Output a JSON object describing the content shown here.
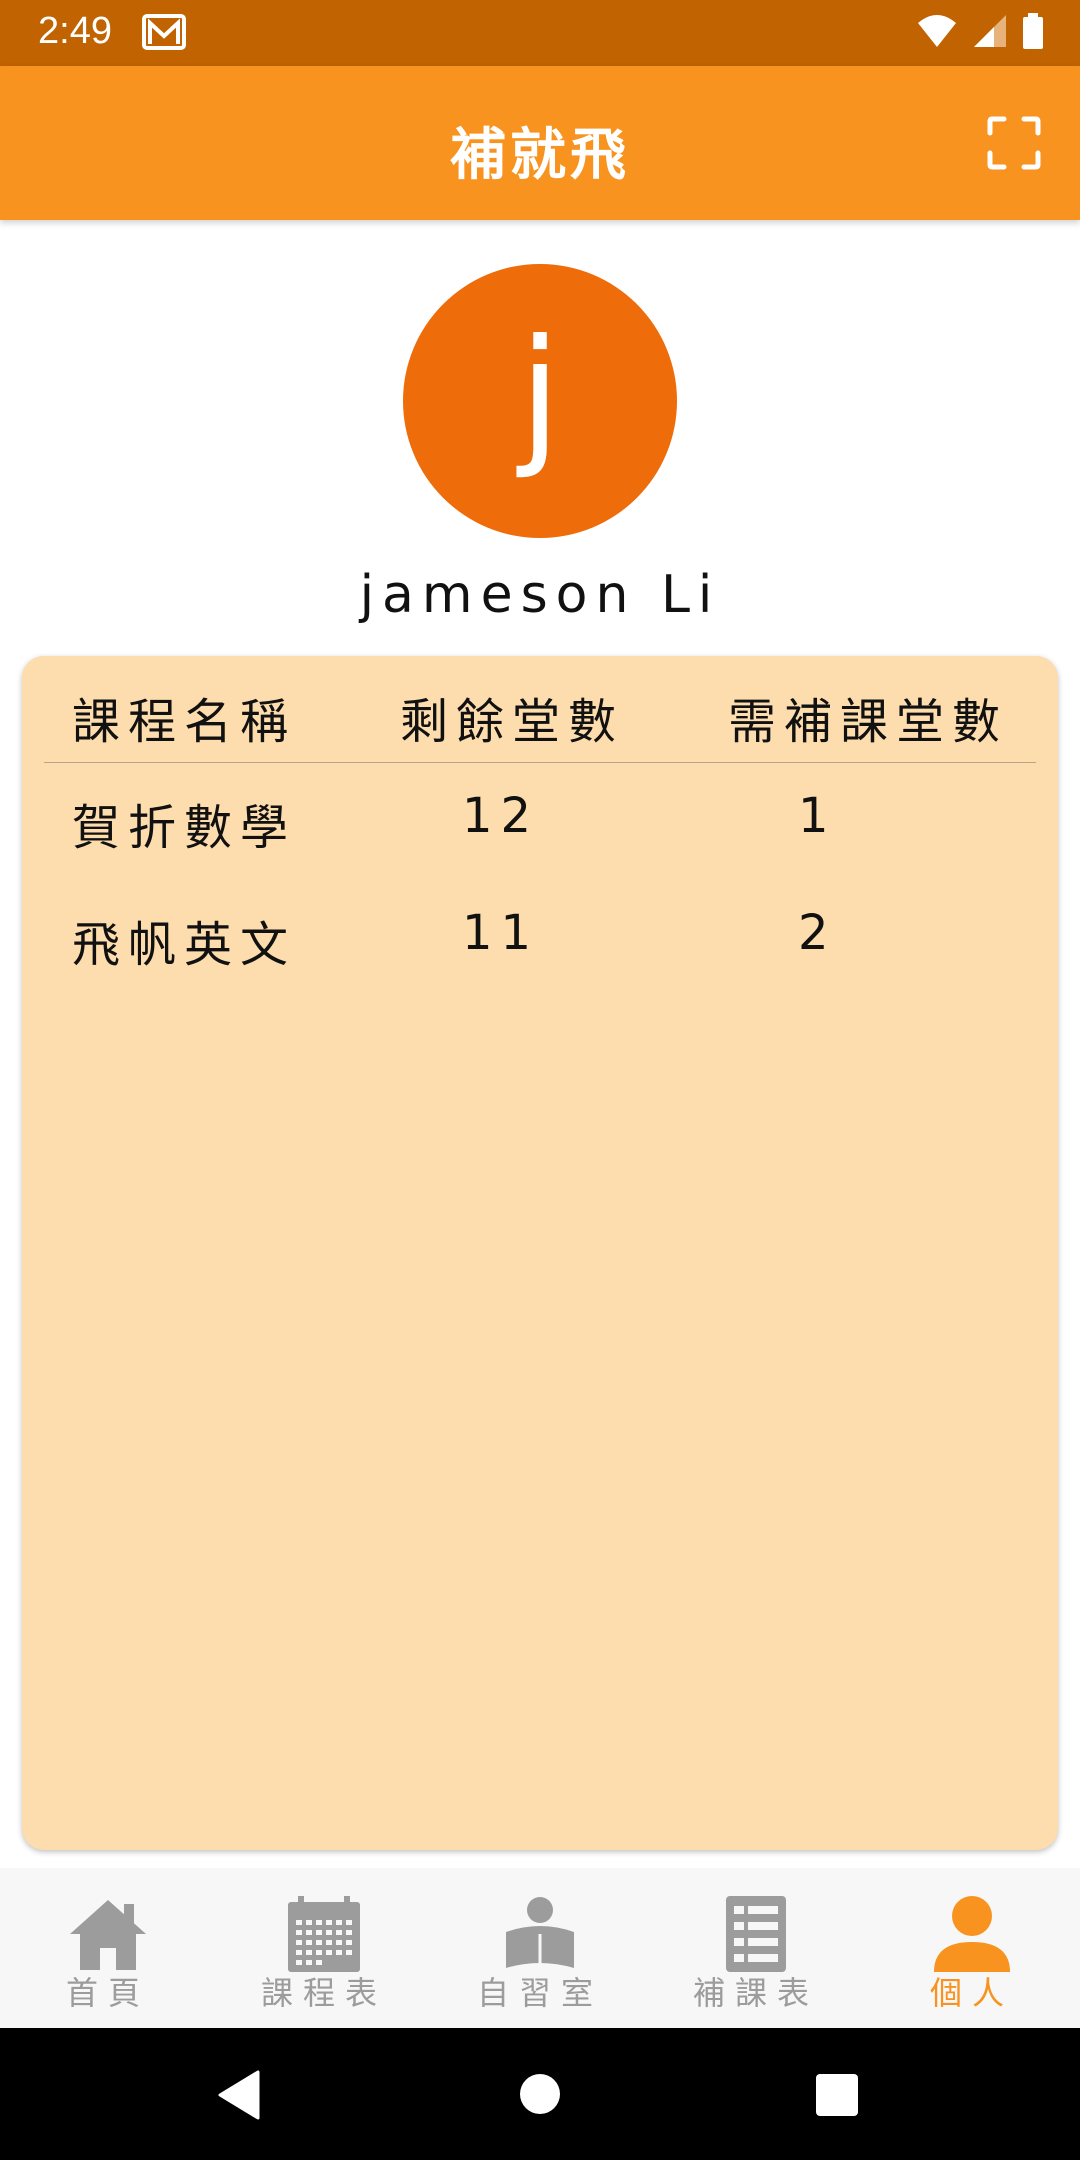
{
  "status_bar": {
    "time": "2:49"
  },
  "app_bar": {
    "title": "補就飛"
  },
  "profile": {
    "avatar_letter": "j",
    "name": "jameson Li"
  },
  "table": {
    "headers": [
      "課程名稱",
      "剩餘堂數",
      "需補課堂數"
    ],
    "rows": [
      {
        "course": "賀折數學",
        "remaining": "12",
        "makeup": "1"
      },
      {
        "course": "飛帆英文",
        "remaining": "11",
        "makeup": "2"
      }
    ]
  },
  "bottom_nav": {
    "items": [
      {
        "label": "首頁",
        "icon": "home-icon"
      },
      {
        "label": "課程表",
        "icon": "calendar-icon"
      },
      {
        "label": "自習室",
        "icon": "study-room-icon"
      },
      {
        "label": "補課表",
        "icon": "list-icon"
      },
      {
        "label": "個人",
        "icon": "person-icon"
      }
    ],
    "active_index": 4
  },
  "colors": {
    "status_bar": "#c06300",
    "app_bar": "#f7931e",
    "avatar": "#ee6c0a",
    "card": "#fddcad",
    "nav_active": "#f7931e",
    "nav_inactive": "#9c9c9c"
  }
}
